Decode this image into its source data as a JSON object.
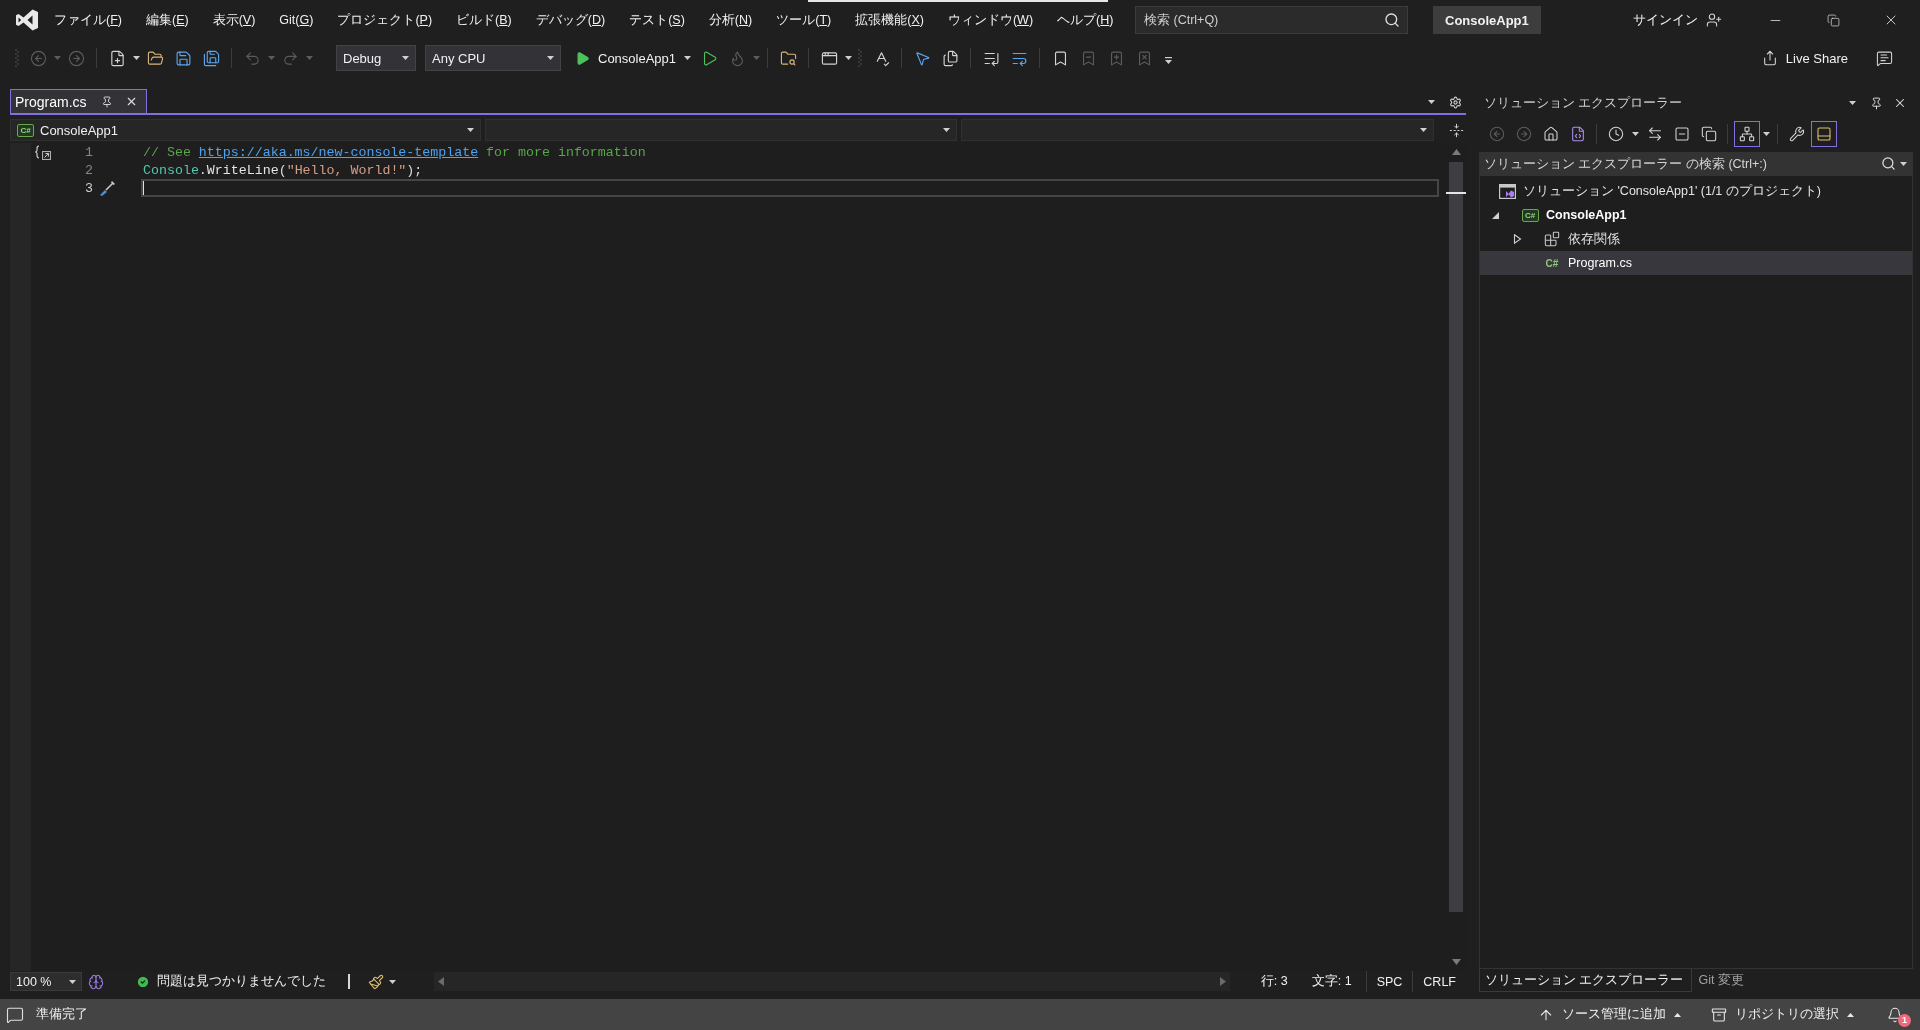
{
  "window": {
    "title": "ConsoleApp1",
    "search": {
      "placeholder": "検索 (Ctrl+Q)"
    },
    "sign_in": "サインイン"
  },
  "menu": [
    "ファイル(F)",
    "編集(E)",
    "表示(V)",
    "Git(G)",
    "プロジェクト(P)",
    "ビルド(B)",
    "デバッグ(D)",
    "テスト(S)",
    "分析(N)",
    "ツール(T)",
    "拡張機能(X)",
    "ウィンドウ(W)",
    "ヘルプ(H)"
  ],
  "toolbar": {
    "items": [
      {
        "kind": "grip"
      },
      {
        "kind": "back",
        "disabled": true,
        "menu": true
      },
      {
        "kind": "forward",
        "disabled": true,
        "menu": false
      },
      {
        "kind": "separator"
      },
      {
        "kind": "newitem",
        "disabled": false,
        "menu": true
      },
      {
        "kind": "open",
        "disabled": false,
        "menu": false
      },
      {
        "kind": "save",
        "disabled": false,
        "menu": false
      },
      {
        "kind": "saveall",
        "disabled": false,
        "menu": false
      },
      {
        "kind": "separator"
      },
      {
        "kind": "undo",
        "disabled": true,
        "menu": true
      },
      {
        "kind": "redo",
        "disabled": true,
        "menu": true
      },
      {
        "kind": "configuration",
        "value": "Debug"
      },
      {
        "kind": "platform",
        "value": "Any CPU"
      },
      {
        "kind": "start",
        "label": "ConsoleApp1"
      },
      {
        "kind": "run",
        "disabled": false,
        "menu": false
      },
      {
        "kind": "hotreload",
        "disabled": true,
        "menu": true
      },
      {
        "kind": "separator"
      },
      {
        "kind": "foldersearch",
        "disabled": false,
        "menu": false
      },
      {
        "kind": "separator"
      },
      {
        "kind": "window",
        "disabled": false,
        "menu": true
      },
      {
        "kind": "grip"
      },
      {
        "kind": "spellcheck",
        "disabled": false,
        "menu": false
      },
      {
        "kind": "separator"
      },
      {
        "kind": "pointer",
        "disabled": false,
        "menu": false
      },
      {
        "kind": "panels",
        "disabled": false,
        "menu": false
      },
      {
        "kind": "separator"
      },
      {
        "kind": "comment",
        "disabled": false,
        "menu": false
      },
      {
        "kind": "uncomment",
        "disabled": false,
        "menu": false
      },
      {
        "kind": "separator"
      },
      {
        "kind": "bookmark",
        "disabled": false,
        "menu": false
      },
      {
        "kind": "bookmarkprev",
        "disabled": true,
        "menu": false
      },
      {
        "kind": "bookmarknext",
        "disabled": true,
        "menu": false
      },
      {
        "kind": "bookmarkclear",
        "disabled": true,
        "menu": false
      },
      {
        "kind": "overflow"
      }
    ],
    "live_share": "Live Share"
  },
  "document_tabs": [
    {
      "label": "Program.cs",
      "selected": true
    }
  ],
  "navigation_bar": {
    "project": {
      "badge": "C#",
      "label": "ConsoleApp1"
    }
  },
  "editor": {
    "lines": [
      {
        "number": "1",
        "current": false,
        "glyph": {
          "kind": "outline"
        },
        "tokens": [
          {
            "kind": "comment",
            "text": "// See "
          },
          {
            "kind": "link",
            "text": "https://aka.ms/new-console-template"
          },
          {
            "kind": "comment",
            "text": " for more information"
          }
        ]
      },
      {
        "number": "2",
        "current": false,
        "tokens": [
          {
            "kind": "type",
            "text": "Console"
          },
          {
            "kind": "plain",
            "text": "."
          },
          {
            "kind": "method",
            "text": "WriteLine"
          },
          {
            "kind": "plain",
            "text": "("
          },
          {
            "kind": "string",
            "text": "\"Hello, World!\""
          },
          {
            "kind": "plain",
            "text": ");"
          }
        ]
      },
      {
        "number": "3",
        "current": true,
        "glyph": {
          "kind": "quickaction"
        }
      }
    ]
  },
  "editor_status": {
    "zoom": "100 %",
    "issues": "問題は見つかりませんでした",
    "line": "行: 3",
    "column": "文字: 1",
    "whitespace": "SPC",
    "line_ending": "CRLF"
  },
  "solution_explorer": {
    "title": "ソリューション エクスプローラー",
    "toolbar": [
      {
        "kind": "back",
        "disabled": true,
        "pressed": false,
        "menu": false
      },
      {
        "kind": "forward",
        "disabled": true,
        "pressed": false,
        "menu": false
      },
      {
        "kind": "home",
        "disabled": false,
        "pressed": false,
        "menu": false
      },
      {
        "kind": "switchviews",
        "disabled": false,
        "pressed": false,
        "menu": false
      },
      {
        "kind": "separator"
      },
      {
        "kind": "pending",
        "disabled": false,
        "pressed": false,
        "menu": true
      },
      {
        "kind": "sync",
        "disabled": false,
        "pressed": false,
        "menu": false
      },
      {
        "kind": "collapse",
        "disabled": false,
        "pressed": false,
        "menu": false
      },
      {
        "kind": "showall",
        "disabled": false,
        "pressed": false,
        "menu": false
      },
      {
        "kind": "separator"
      },
      {
        "kind": "treeview",
        "disabled": false,
        "pressed": true,
        "menu": true
      },
      {
        "kind": "separator"
      },
      {
        "kind": "properties",
        "disabled": false,
        "pressed": false,
        "menu": false
      },
      {
        "kind": "preview",
        "disabled": false,
        "pressed": true,
        "menu": false
      }
    ],
    "search": {
      "placeholder": "ソリューション エクスプローラー の検索 (Ctrl+:)"
    },
    "tree": [
      {
        "kind": "solution",
        "label": "ソリューション 'ConsoleApp1' (1/1 のプロジェクト)",
        "selected": false,
        "startup": false,
        "children": [
          {
            "kind": "project",
            "badge": "C#",
            "label": "ConsoleApp1",
            "selected": false,
            "startup": true,
            "expanded": true,
            "children": [
              {
                "kind": "dependencies",
                "label": "依存関係",
                "selected": false,
                "startup": false,
                "expanded": false
              },
              {
                "kind": "file",
                "badge": "C#",
                "label": "Program.cs",
                "selected": true,
                "startup": false
              }
            ]
          }
        ]
      }
    ],
    "tabs": [
      {
        "label": "ソリューション エクスプローラー",
        "selected": true
      },
      {
        "label": "Git 変更",
        "selected": false
      }
    ]
  },
  "status_bar": {
    "message": "準備完了",
    "items": [
      {
        "kind": "publish",
        "label": "ソース管理に追加"
      },
      {
        "kind": "repository",
        "label": "リポジトリの選択"
      }
    ],
    "notifications": {
      "count": "1"
    }
  }
}
